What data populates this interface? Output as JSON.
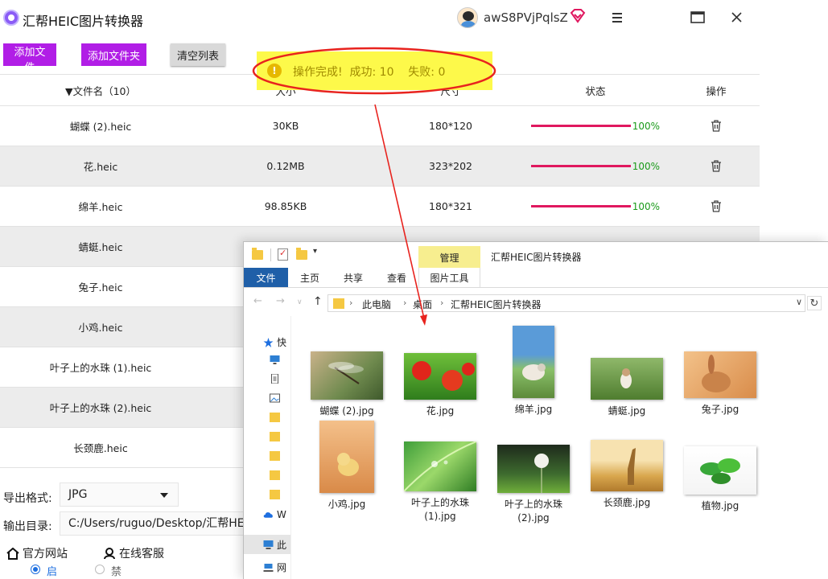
{
  "app": {
    "title": "汇帮HEIC图片转换器",
    "username": "awS8PVjPqlsZ",
    "toolbar": {
      "add_file": "添加文件",
      "add_folder": "添加文件夹",
      "clear_list": "清空列表"
    },
    "notice": {
      "text": "操作完成!  成功: 10    失败: 0"
    },
    "table": {
      "headers": {
        "name": "▼文件名（10）",
        "size": "大小",
        "dim": "尺寸",
        "status": "状态",
        "op": "操作"
      },
      "rows": [
        {
          "name": "蝴蝶 (2).heic",
          "size": "30KB",
          "dim": "180*120",
          "progress": "100%"
        },
        {
          "name": "花.heic",
          "size": "0.12MB",
          "dim": "323*202",
          "progress": "100%"
        },
        {
          "name": "绵羊.heic",
          "size": "98.85KB",
          "dim": "180*321",
          "progress": "100%"
        },
        {
          "name": "蜻蜓.heic"
        },
        {
          "name": "兔子.heic"
        },
        {
          "name": "小鸡.heic"
        },
        {
          "name": "叶子上的水珠 (1).heic"
        },
        {
          "name": "叶子上的水珠 (2).heic"
        },
        {
          "name": "长颈鹿.heic"
        }
      ]
    },
    "bottom": {
      "format_label": "导出格式:",
      "format_value": "JPG",
      "dir_label": "输出目录:",
      "dir_value": "C:/Users/ruguo/Desktop/汇帮HE",
      "site_link": "官方网站",
      "service_link": "在线客服",
      "radio_on": "启用",
      "radio_off": "禁用"
    }
  },
  "explorer": {
    "ribbon_context": "管理",
    "title": "汇帮HEIC图片转换器",
    "tabs": {
      "file": "文件",
      "home": "主页",
      "share": "共享",
      "view": "查看",
      "picture_tools": "图片工具"
    },
    "breadcrumb": [
      "此电脑",
      "桌面",
      "汇帮HEIC图片转换器"
    ],
    "nav_pane": [
      "快",
      "W",
      "此",
      "网"
    ],
    "files": [
      {
        "label": "蝴蝶 (2).jpg",
        "kind": "dragonfly"
      },
      {
        "label": "花.jpg",
        "kind": "flower"
      },
      {
        "label": "绵羊.jpg",
        "kind": "sheep"
      },
      {
        "label": "蜻蜓.jpg",
        "kind": "dog"
      },
      {
        "label": "兔子.jpg",
        "kind": "rabbit"
      },
      {
        "label": "小鸡.jpg",
        "kind": "chick"
      },
      {
        "label": "叶子上的水珠\n(1).jpg",
        "kind": "leaf"
      },
      {
        "label": "叶子上的水珠\n(2).jpg",
        "kind": "dandelion"
      },
      {
        "label": "长颈鹿.jpg",
        "kind": "giraffe"
      },
      {
        "label": "植物.jpg",
        "kind": "plant"
      }
    ]
  },
  "colors": {
    "accent": "#b11ee6",
    "progress": "#e0185f",
    "percent": "#1a9a1a",
    "notice_bg": "#fdf94a",
    "highlight": "#e8231e"
  }
}
